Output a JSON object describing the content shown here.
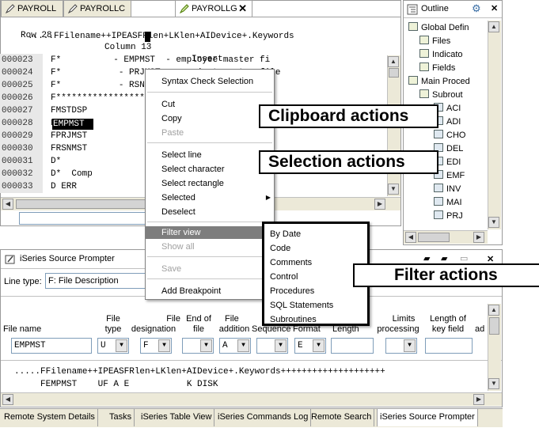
{
  "editor": {
    "tabs": [
      "PAYROLL",
      "PAYROLLC",
      "PAYROLLG"
    ],
    "status": {
      "row": "Row 28",
      "column": "Column 13",
      "mode": "Insert"
    },
    "ruler": ".....FFilename++IPEASFRlen+LKlen+AIDevice+.Keywords",
    "lines": [
      {
        "num": "000023",
        "text": "F*          - EMPMST  - employee master fi"
      },
      {
        "num": "000024",
        "text": "F*           - PRJMST  - project master file"
      },
      {
        "num": "000025",
        "text": "F*           - RSNMST  - reason code master"
      },
      {
        "num": "000026",
        "text": "F*****************************************"
      },
      {
        "num": "000027",
        "text": "FMSTDSP                      WORKSTN"
      },
      {
        "num": "000028",
        "text": "FEMPMST                      K DISK"
      },
      {
        "num": "000029",
        "text": "FPRJMST                      K DISK"
      },
      {
        "num": "000030",
        "text": "FRSNMST                      K DISK"
      },
      {
        "num": "000031",
        "text": "D*"
      },
      {
        "num": "000032",
        "text": "D*  Comp          aining error des"
      },
      {
        "num": "000033",
        "text": "D ERR                 50  DIM(10"
      }
    ]
  },
  "outline": {
    "title": "Outline",
    "items": [
      "Global Defin",
      "Files",
      "Indicato",
      "Fields",
      "Main Proced",
      "Subrout",
      "ACI",
      "ADI",
      "CHO",
      "DEL",
      "EDI",
      "EMF",
      "INV",
      "MAI",
      "PRJ"
    ]
  },
  "context_menu": {
    "items": [
      "Syntax Check Selection",
      "Cut",
      "Copy",
      "Paste",
      "Select line",
      "Select character",
      "Select rectangle",
      "Selected",
      "Deselect",
      "Filter view",
      "Show all",
      "Save",
      "Add Breakpoint"
    ]
  },
  "submenu": {
    "items": [
      "By Date",
      "Code",
      "Comments",
      "Control",
      "Procedures",
      "SQL Statements",
      "Subroutines"
    ]
  },
  "callouts": {
    "clipboard": "Clipboard actions",
    "selection": "Selection actions",
    "filter": "Filter actions"
  },
  "prompter": {
    "title": "iSeries Source Prompter",
    "line_type_label": "Line type:",
    "line_type_value": "F: File Description",
    "headers": {
      "file_name": "File name",
      "file_type": [
        "File",
        "type"
      ],
      "file_designation": [
        "File",
        "designation"
      ],
      "end_of_file": [
        "End of",
        "file"
      ],
      "file_addition": [
        "File",
        "addition"
      ],
      "sequence": "Sequence",
      "format": "Format",
      "length": "Length",
      "limits": [
        "Limits",
        "processing"
      ],
      "length_key": [
        "Length of",
        "key field"
      ],
      "ad": "ad"
    },
    "values": {
      "file_name": "EMPMST",
      "type": "U",
      "designation": "F",
      "addition": "A",
      "format": "E"
    },
    "ruler": ".....FFilename++IPEASFRlen+LKlen+AIDevice+.Keywords++++++++++++++++++++",
    "preview": "     FEMPMST    UF A E           K DISK"
  },
  "bottom_tabs": [
    "Remote System Details",
    "Tasks",
    "iSeries Table View",
    "iSeries Commands Log",
    "Remote Search",
    "iSeries Source Prompter"
  ]
}
